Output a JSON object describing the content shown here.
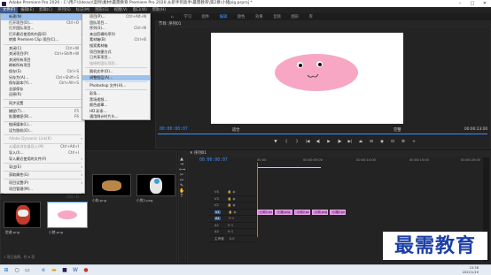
{
  "window": {
    "title": "Adobe Premiere Pro 2020 - C:\\用户\\(Ideas)\\案例\\素材\\最需教育 Premiere Pro 2020 从新手到高手\\最需教育\\第2章\\小猪pig.prproj *"
  },
  "menubar": [
    "文件(F)",
    "编辑(E)",
    "剪辑(C)",
    "序列(S)",
    "标记(M)",
    "图形(G)",
    "视图(V)",
    "窗口(W)",
    "帮助(H)"
  ],
  "workspace_tabs": [
    "学习",
    "组件",
    "编辑",
    "颜色",
    "效果",
    "音频",
    "图形",
    "库"
  ],
  "file_menu": [
    {
      "label": "新建(N)",
      "shortcut": "",
      "arrow": "›",
      "state": "hl"
    },
    {
      "label": "打开项目(O)...",
      "shortcut": "Ctrl+O"
    },
    {
      "label": "打开团队项目...",
      "shortcut": ""
    },
    {
      "label": "打开最近使用的内容(E)",
      "shortcut": "",
      "arrow": "›"
    },
    {
      "label": "转换 Premiere Clip 项目(C)...",
      "shortcut": ""
    },
    {
      "sep": true
    },
    {
      "label": "关闭(C)",
      "shortcut": "Ctrl+W"
    },
    {
      "label": "关闭项目(P)",
      "shortcut": "Ctrl+Shift+W"
    },
    {
      "label": "关闭所有项目",
      "shortcut": ""
    },
    {
      "label": "刷新所有项目",
      "shortcut": ""
    },
    {
      "label": "保存(S)",
      "shortcut": "Ctrl+S"
    },
    {
      "label": "另存为(A)...",
      "shortcut": "Ctrl+Shift+S"
    },
    {
      "label": "保存副本(Y)...",
      "shortcut": "Ctrl+Alt+S"
    },
    {
      "label": "全部保存",
      "shortcut": ""
    },
    {
      "label": "还原(R)",
      "shortcut": ""
    },
    {
      "sep": true
    },
    {
      "label": "同步设置",
      "shortcut": "",
      "arrow": "›"
    },
    {
      "sep": true
    },
    {
      "label": "捕捉(T)...",
      "shortcut": "F5"
    },
    {
      "label": "批量捕捉(B)...",
      "shortcut": "F6"
    },
    {
      "sep": true
    },
    {
      "label": "链接媒体(L)...",
      "shortcut": ""
    },
    {
      "label": "设为脱机(O)...",
      "shortcut": ""
    },
    {
      "sep": true
    },
    {
      "label": "Adobe Dynamic Link(K)",
      "shortcut": "",
      "arrow": "›",
      "state": "dis"
    },
    {
      "sep": true
    },
    {
      "label": "从媒体浏览器导入(M)",
      "shortcut": "Ctrl+Alt+I",
      "state": "dis"
    },
    {
      "label": "导入(I)...",
      "shortcut": "Ctrl+I"
    },
    {
      "label": "导入最近使用的文件(F)",
      "shortcut": "",
      "arrow": "›"
    },
    {
      "sep": true
    },
    {
      "label": "导出(E)",
      "shortcut": "",
      "arrow": "›"
    },
    {
      "sep": true
    },
    {
      "label": "获取属性(G)",
      "shortcut": "",
      "arrow": "›"
    },
    {
      "sep": true
    },
    {
      "label": "项目设置(P)",
      "shortcut": "",
      "arrow": "›"
    },
    {
      "label": "项目管理(M)...",
      "shortcut": ""
    },
    {
      "sep": true
    },
    {
      "label": "退出(X)",
      "shortcut": "Ctrl+Q"
    }
  ],
  "new_submenu": [
    {
      "label": "项目(P)...",
      "shortcut": "Ctrl+Alt+N"
    },
    {
      "label": "团队项目...",
      "shortcut": ""
    },
    {
      "label": "序列(S)...",
      "shortcut": "Ctrl+N"
    },
    {
      "label": "来自剪辑的序列",
      "shortcut": ""
    },
    {
      "label": "素材箱(B)",
      "shortcut": "Ctrl+B"
    },
    {
      "label": "搜索素材箱",
      "shortcut": ""
    },
    {
      "label": "项目快捷方式",
      "shortcut": ""
    },
    {
      "label": "已共享项目...",
      "shortcut": ""
    },
    {
      "label": "链接的团队项目...",
      "shortcut": "",
      "state": "dis"
    },
    {
      "sep": true
    },
    {
      "label": "脱机文件(O)...",
      "shortcut": ""
    },
    {
      "label": "调整图层(A)...",
      "shortcut": "",
      "state": "hl"
    },
    {
      "sep": true
    },
    {
      "label": "Photoshop 文件(H)...",
      "shortcut": ""
    },
    {
      "sep": true
    },
    {
      "label": "彩条...",
      "shortcut": ""
    },
    {
      "label": "黑场视频...",
      "shortcut": ""
    },
    {
      "label": "颜色遮罩...",
      "shortcut": ""
    },
    {
      "label": "HD 彩条...",
      "shortcut": ""
    },
    {
      "label": "通用倒计时片头...",
      "shortcut": ""
    },
    {
      "label": "透明视频...",
      "shortcut": ""
    }
  ],
  "program_monitor": {
    "title": "节目: 序列01",
    "timecode_left": "00:00:00:07",
    "timecode_right": "00:00:23:00",
    "fit": "适合",
    "quality": "完整"
  },
  "project_panel": {
    "search_placeholder": "",
    "info": "1 项已选择，共 6 项",
    "items": [
      {
        "name": "小猪2.png",
        "duration": "4:29"
      },
      {
        "name": "小狗2.png",
        "duration": "4:29"
      },
      {
        "name": "小狗.png",
        "duration": "4:29"
      },
      {
        "name": "小熊2.png",
        "duration": "4:29"
      },
      {
        "name": "脸谱.png",
        "duration": "4:29"
      },
      {
        "name": "小猪.png",
        "duration": "4:29"
      }
    ]
  },
  "timeline": {
    "title": "序列01",
    "timecode": "00:00:00:07",
    "ruler": [
      "00:00",
      "00:00:05:00",
      "00:00:10:00",
      "00:00:15:00",
      "00:00:20:00"
    ],
    "tracks": [
      "V4",
      "V3",
      "V2",
      "V1",
      "A1",
      "A2",
      "A3",
      "主声道"
    ],
    "master_value": "0.0",
    "clips": [
      "小狗2.png",
      "小猪.png",
      "小熊2.png",
      "小狗.png",
      "小猪2.png"
    ]
  },
  "taskbar": {
    "time": "15:36",
    "date": "2022/1/10"
  },
  "watermark": "最需教育",
  "colors": {
    "accent": "#3a8eff",
    "menu_highlight": "#9cc3ef",
    "pig": "#f7a7c4",
    "clip": "#d988d9"
  }
}
